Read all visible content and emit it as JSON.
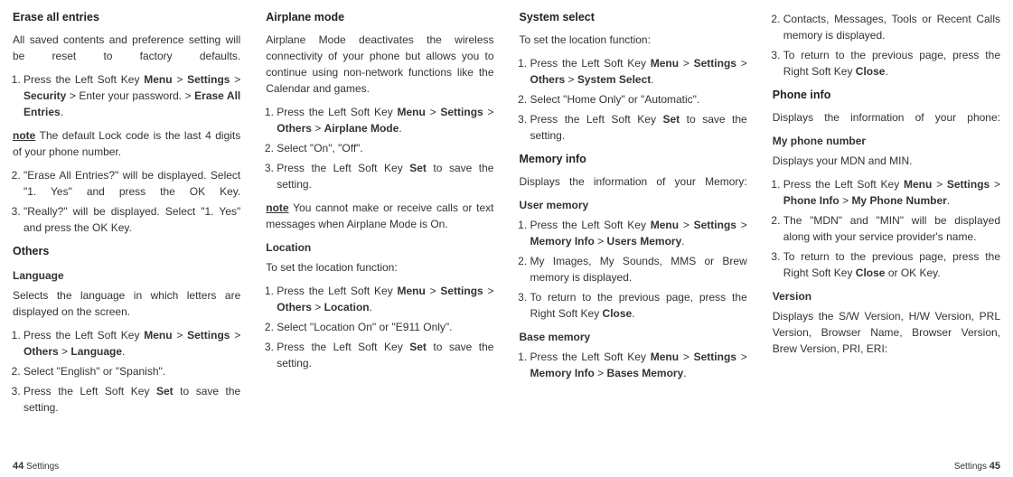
{
  "col1": {
    "h_erase": "Erase all entries",
    "erase_desc": "All saved contents and preference setting will be reset to factory defaults.",
    "erase_li1_pre": "Press the Left Soft Key ",
    "erase_li1_b1": "Menu",
    "erase_li1_gt1": " > ",
    "erase_li1_b2": "Settings",
    "erase_li1_gt2": " > ",
    "erase_li1_b3": "Security",
    "erase_li1_mid": " > Enter your password. > ",
    "erase_li1_b4": "Erase All Entries",
    "erase_li1_dot": ".",
    "note_label": "note",
    "erase_note": " The default Lock code is the last 4 digits of your phone number.",
    "erase_li2": "\"Erase All Entries?\" will be displayed. Select \"1. Yes\" and press the OK Key.",
    "erase_li3": "\"Really?\" will be displayed. Select \"1. Yes\" and press the OK Key.",
    "h_others": "Others",
    "h_language": "Language",
    "lang_desc": "Selects the language in which letters are displayed on the screen.",
    "lang_li1_pre": "Press the Left Soft Key ",
    "lang_li1_b1": "Menu",
    "lang_li1_gt1": " > ",
    "lang_li1_b2": "Settings",
    "lang_li1_gt2": " > ",
    "lang_li1_b3": "Others",
    "lang_li1_gt3": " > ",
    "lang_li1_b4": "Language",
    "lang_li1_dot": ".",
    "lang_li2": "Select \"English\" or \"Spanish\".",
    "lang_li3_pre": "Press the Left Soft Key ",
    "lang_li3_b": "Set",
    "lang_li3_post": " to save the setting.",
    "footer_label": "Settings",
    "footer_page": "44"
  },
  "col2": {
    "h_airplane": "Airplane mode",
    "air_desc": "Airplane Mode deactivates the wireless connectivity of your phone but allows you to continue using non-network functions like the Calendar and games.",
    "air_li1_pre": "Press the Left Soft Key ",
    "air_li1_b1": "Menu",
    "air_li1_gt1": " > ",
    "air_li1_b2": "Settings",
    "air_li1_gt2": " > ",
    "air_li1_b3": "Others",
    "air_li1_gt3": " > ",
    "air_li1_b4": "Airplane Mode",
    "air_li1_dot": ".",
    "air_li2": "Select \"On\", \"Off\".",
    "air_li3_pre": "Press the Left Soft Key ",
    "air_li3_b": "Set",
    "air_li3_post": " to save the setting.",
    "air_note": " You cannot make or receive calls or text messages when Airplane Mode is On.",
    "h_location": "Location",
    "loc_desc": "To set the location function:",
    "loc_li1_pre": "Press the Left Soft Key ",
    "loc_li1_b1": "Menu",
    "loc_li1_gt1": " > ",
    "loc_li1_b2": "Settings",
    "loc_li1_gt2": " > ",
    "loc_li1_b3": "Others",
    "loc_li1_gt3": " > ",
    "loc_li1_b4": "Location",
    "loc_li1_dot": ".",
    "loc_li2": "Select \"Location On\" or \"E911 Only\".",
    "loc_li3_pre": "Press the Left Soft Key ",
    "loc_li3_b": "Set",
    "loc_li3_post": " to save the setting."
  },
  "col3": {
    "h_system": "System select",
    "sys_desc": "To set the location function:",
    "sys_li1_pre": "Press the Left Soft Key ",
    "sys_li1_b1": "Menu",
    "sys_li1_gt1": " > ",
    "sys_li1_b2": "Settings",
    "sys_li1_gt2": " > ",
    "sys_li1_b3": "Others",
    "sys_li1_gt3": " > ",
    "sys_li1_b4": "System Select",
    "sys_li1_dot": ".",
    "sys_li2": "Select \"Home Only\" or \"Automatic\".",
    "sys_li3_pre": "Press the Left Soft Key ",
    "sys_li3_b": "Set",
    "sys_li3_post": " to save the setting.",
    "h_meminfo": "Memory info",
    "mem_desc": "Displays the information of your Memory:",
    "h_usermem": "User memory",
    "um_li1_pre": "Press the Left Soft Key ",
    "um_li1_b1": "Menu",
    "um_li1_gt1": " > ",
    "um_li1_b2": "Settings",
    "um_li1_gt2": " > ",
    "um_li1_b3": "Memory Info",
    "um_li1_gt3": " > ",
    "um_li1_b4": "Users Memory",
    "um_li1_dot": ".",
    "um_li2": "My Images, My Sounds, MMS or Brew memory is displayed.",
    "um_li3_pre": "To return to the previous page, press the Right Soft Key ",
    "um_li3_b": "Close",
    "um_li3_dot": ".",
    "h_basemem": "Base memory",
    "bm_li1_pre": "Press the Left Soft Key ",
    "bm_li1_b1": "Menu",
    "bm_li1_gt1": " > ",
    "bm_li1_b2": "Settings",
    "bm_li1_gt2": " > ",
    "bm_li1_b3": "Memory Info",
    "bm_li1_gt3": " > ",
    "bm_li1_b4": "Bases Memory",
    "bm_li1_dot": "."
  },
  "col4": {
    "bm_li2": "Contacts, Messages, Tools or Recent Calls memory is displayed.",
    "bm_li3_pre": "To return to the previous page, press the Right Soft Key ",
    "bm_li3_b": "Close",
    "bm_li3_dot": ".",
    "h_phoneinfo": "Phone info",
    "phone_desc": "Displays the information of your phone:",
    "h_mynumber": "My phone number",
    "mn_desc": "Displays your MDN and MIN.",
    "mn_li1_pre": "Press the Left Soft Key ",
    "mn_li1_b1": "Menu",
    "mn_li1_gt1": " > ",
    "mn_li1_b2": "Settings",
    "mn_li1_gt2": " > ",
    "mn_li1_b3": "Phone Info",
    "mn_li1_gt3": " > ",
    "mn_li1_b4": "My Phone Number",
    "mn_li1_dot": ".",
    "mn_li2": "The \"MDN\" and \"MIN\" will be displayed along with your service provider's name.",
    "mn_li3_pre": "To return to the previous page, press the Right Soft Key ",
    "mn_li3_b": "Close",
    "mn_li3_post": " or OK Key.",
    "h_version": "Version",
    "ver_desc": "Displays the S/W Version, H/W Version, PRL Version, Browser Name, Browser Version, Brew Version, PRI, ERI:",
    "footer_label": "Settings",
    "footer_page": "45"
  }
}
